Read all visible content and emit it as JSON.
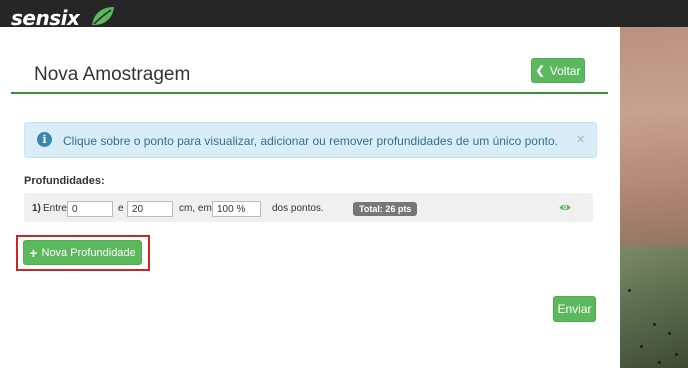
{
  "header": {
    "logo_text": "sensix"
  },
  "page": {
    "title": "Nova Amostragem",
    "back_label": "Voltar"
  },
  "alert": {
    "message": "Clique sobre o ponto para visualizar, adicionar ou remover profundidades de um único ponto.",
    "close_symbol": "×"
  },
  "depths": {
    "label": "Profundidades:",
    "rows": [
      {
        "index": "1)",
        "entre": "Entre",
        "from_value": "0",
        "e": "e",
        "to_value": "20",
        "unit_em": "cm, em",
        "percent_value": "100 %",
        "suffix": "dos pontos.",
        "total_badge": "Total: 26 pts"
      }
    ]
  },
  "actions": {
    "add_depth_label": "Nova Profundidade",
    "submit_label": "Enviar"
  },
  "colors": {
    "brand_green": "#5cb85c",
    "topbar": "#262626",
    "highlight": "#c62828"
  }
}
